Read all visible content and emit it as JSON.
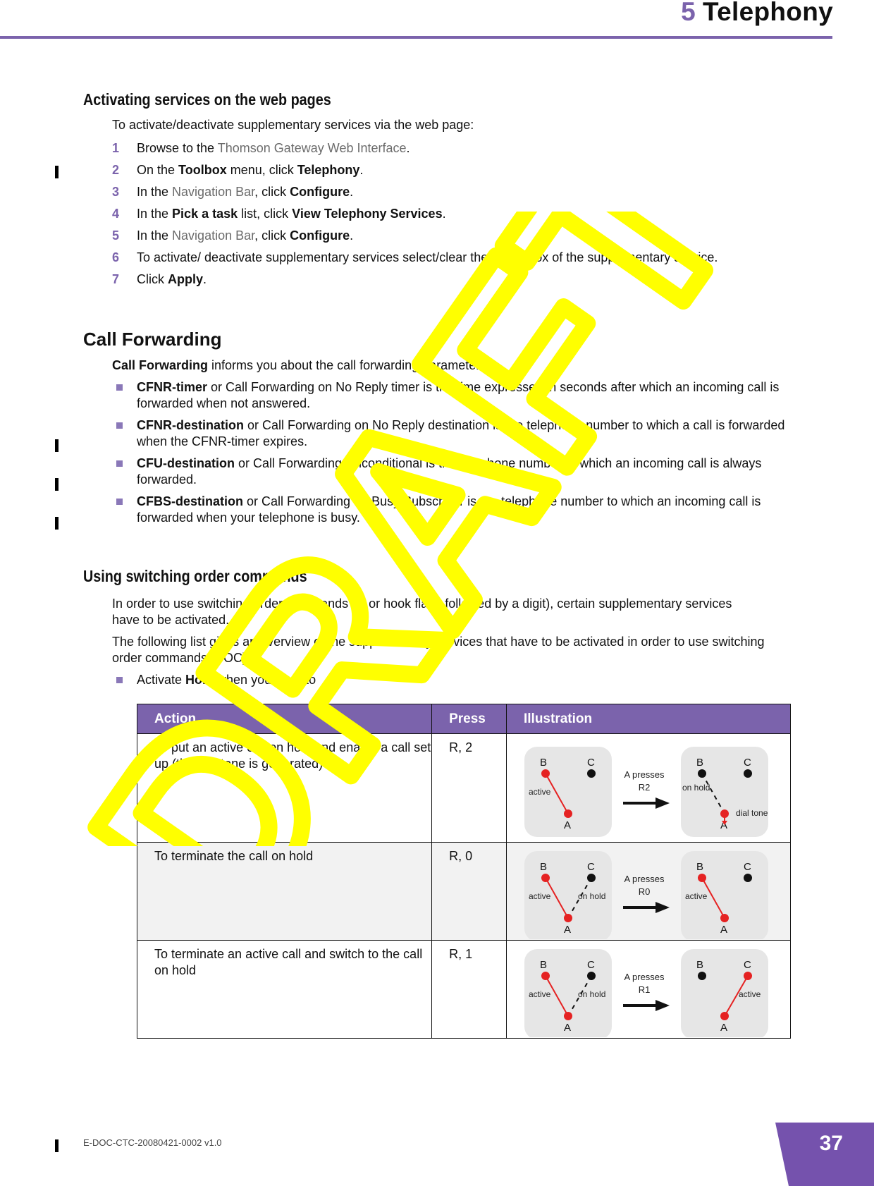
{
  "header": {
    "chapter_number": "5",
    "chapter_title": "Telephony"
  },
  "section_activating": {
    "heading": "Activating services on the web pages",
    "intro": "To activate/deactivate supplementary services via the web page:",
    "steps": [
      {
        "n": "1",
        "parts": [
          {
            "t": "Browse to the ",
            "s": "n"
          },
          {
            "t": "Thomson Gateway Web Interface",
            "s": "g"
          },
          {
            "t": ".",
            "s": "n"
          }
        ]
      },
      {
        "n": "2",
        "parts": [
          {
            "t": "On the ",
            "s": "n"
          },
          {
            "t": "Toolbox",
            "s": "b"
          },
          {
            "t": " menu, click ",
            "s": "n"
          },
          {
            "t": "Telephony",
            "s": "b"
          },
          {
            "t": ".",
            "s": "n"
          }
        ]
      },
      {
        "n": "3",
        "parts": [
          {
            "t": "In the ",
            "s": "n"
          },
          {
            "t": "Navigation Bar",
            "s": "g"
          },
          {
            "t": ", click ",
            "s": "n"
          },
          {
            "t": "Configure",
            "s": "b"
          },
          {
            "t": ".",
            "s": "n"
          }
        ]
      },
      {
        "n": "4",
        "parts": [
          {
            "t": "In the ",
            "s": "n"
          },
          {
            "t": "Pick a task",
            "s": "b"
          },
          {
            "t": " list, click ",
            "s": "n"
          },
          {
            "t": "View Telephony Services",
            "s": "b"
          },
          {
            "t": ".",
            "s": "n"
          }
        ]
      },
      {
        "n": "5",
        "parts": [
          {
            "t": "In the ",
            "s": "n"
          },
          {
            "t": "Navigation Bar",
            "s": "g"
          },
          {
            "t": ", click ",
            "s": "n"
          },
          {
            "t": "Configure",
            "s": "b"
          },
          {
            "t": ".",
            "s": "n"
          }
        ]
      },
      {
        "n": "6",
        "parts": [
          {
            "t": "To activate/ deactivate supplementary services select/clear the check box of the supplementary service.",
            "s": "n"
          }
        ]
      },
      {
        "n": "7",
        "parts": [
          {
            "t": "Click ",
            "s": "n"
          },
          {
            "t": "Apply",
            "s": "b"
          },
          {
            "t": ".",
            "s": "n"
          }
        ]
      }
    ]
  },
  "section_call_forwarding": {
    "heading": "Call Forwarding",
    "intro_bold": "Call Forwarding",
    "intro_rest": " informs you about the call forwarding parameters:",
    "bullets": [
      {
        "term": "CFNR-timer",
        "desc": " or Call Forwarding on No Reply timer is the time expressed in seconds after which an incoming call is forwarded when not answered."
      },
      {
        "term": "CFNR-destination",
        "desc": " or Call Forwarding on No Reply destination is the telephone number to which a call is forwarded when the CFNR-timer expires."
      },
      {
        "term": "CFU-destination",
        "desc": " or Call Forwarding Unconditional is the telephone number to which an incoming call is always forwarded."
      },
      {
        "term": "CFBS-destination",
        "desc": " or Call Forwarding on Busy Subscriber is the telephone number to which an incoming call is forwarded when your telephone is busy."
      }
    ]
  },
  "section_soc": {
    "heading": "Using switching order commands",
    "para1": "In order to use switching order commands (R or hook flash followed by a digit), certain supplementary services have to be activated.",
    "para2": "The following list gives an overview of the supplementary services that have to be activated in order to use switching order commands (SOC):",
    "bullet_pre": "Activate ",
    "bullet_bold": "Hold",
    "bullet_post": " when you want to",
    "table": {
      "headers": [
        "Action",
        "Press",
        "Illustration"
      ],
      "rows": [
        {
          "action": "To put an active call on hold and enable a call set up (the dial tone is generated)",
          "press": "R, 2",
          "illustration": {
            "arrow_label_1": "A presses",
            "arrow_label_2": "R2",
            "before": {
              "labels": [
                "B",
                "C",
                "A"
              ],
              "active": "active"
            },
            "after": {
              "labels": [
                "B",
                "C",
                "A"
              ],
              "on_hold": "on hold",
              "dial_tone": "dial tone"
            }
          }
        },
        {
          "action": "To terminate the call on hold",
          "press": "R, 0",
          "illustration": {
            "arrow_label_1": "A presses",
            "arrow_label_2": "R0",
            "before": {
              "labels": [
                "B",
                "C",
                "A"
              ],
              "active": "active",
              "on_hold": "on hold"
            },
            "after": {
              "labels": [
                "B",
                "C",
                "A"
              ],
              "active": "active"
            }
          }
        },
        {
          "action": "To terminate an active call and switch to the call on hold",
          "press": "R, 1",
          "illustration": {
            "arrow_label_1": "A presses",
            "arrow_label_2": "R1",
            "before": {
              "labels": [
                "B",
                "C",
                "A"
              ],
              "active": "active",
              "on_hold": "on hold"
            },
            "after": {
              "labels": [
                "B",
                "C",
                "A"
              ],
              "active": "active"
            }
          }
        }
      ]
    }
  },
  "footer": {
    "doc_id": "E-DOC-CTC-20080421-0002 v1.0",
    "page_number": "37"
  },
  "watermark": {
    "text": "DRAFT",
    "color": "#ffff00"
  },
  "colors": {
    "accent": "#7b63ac",
    "active_line": "#e52222",
    "link_gray": "#6b6b6b"
  }
}
